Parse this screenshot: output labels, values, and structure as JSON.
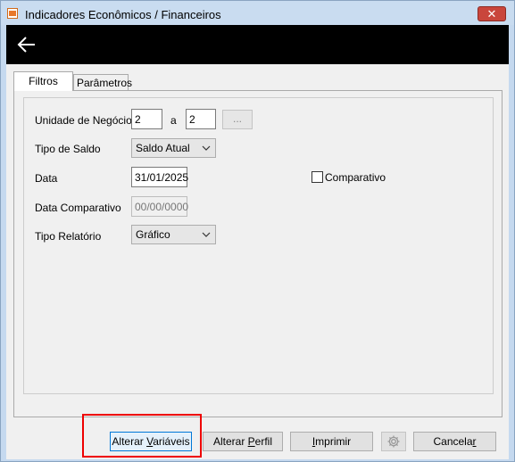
{
  "window": {
    "title": "Indicadores Econômicos / Financeiros",
    "close_glyph": "✕"
  },
  "tabs": [
    {
      "label": "Filtros"
    },
    {
      "label": "Parâmetros"
    }
  ],
  "form": {
    "unidade_label": "Unidade de Negócio",
    "unidade_from": "2",
    "unidade_sep": "a",
    "unidade_to": "2",
    "unidade_lookup": "...",
    "tipo_saldo_label": "Tipo de Saldo",
    "tipo_saldo_value": "Saldo Atual",
    "data_label": "Data",
    "data_value": "31/01/2025",
    "comparativo_label": "Comparativo",
    "data_comp_label": "Data Comparativo",
    "data_comp_value": "00/00/0000",
    "tipo_relatorio_label": "Tipo Relatório",
    "tipo_relatorio_value": "Gráfico"
  },
  "buttons": {
    "alterar_variaveis": {
      "pre": "Alterar ",
      "ul": "V",
      "post": "ariáveis"
    },
    "alterar_perfil": {
      "pre": "Alterar ",
      "ul": "P",
      "post": "erfil"
    },
    "imprimir": {
      "pre": "",
      "ul": "I",
      "post": "mprimir"
    },
    "cancelar": {
      "pre": "Cancela",
      "ul": "r",
      "post": ""
    }
  },
  "colors": {
    "header": "#000000",
    "highlight": "#e00000",
    "accent": "#0078d7"
  }
}
